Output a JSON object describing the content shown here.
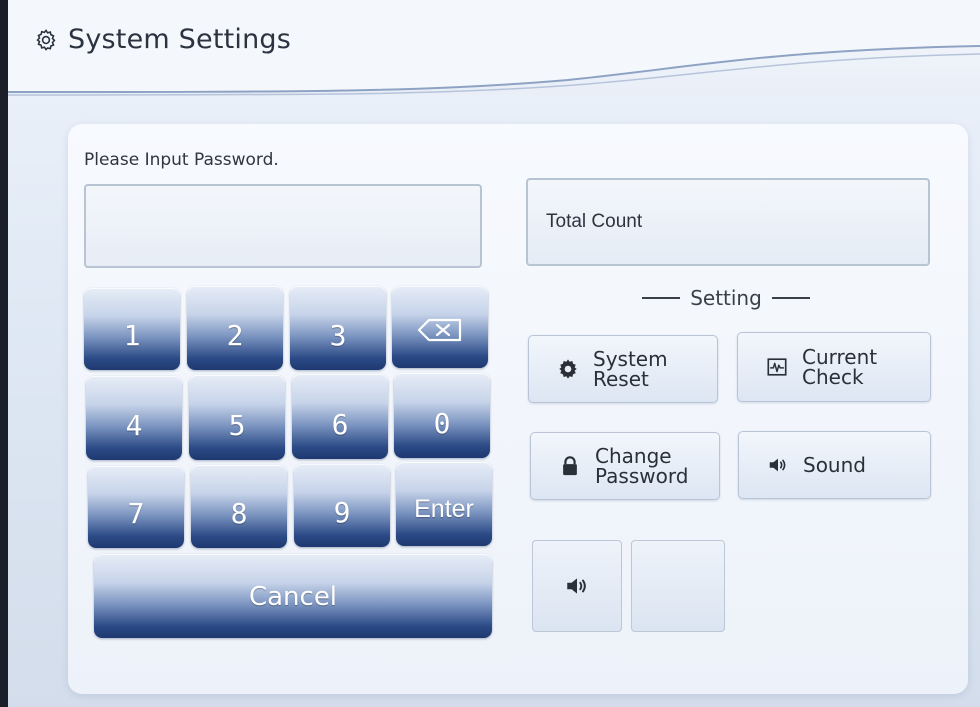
{
  "header": {
    "title": "System Settings",
    "icon": "gear-icon"
  },
  "password": {
    "prompt": "Please Input Password.",
    "value": ""
  },
  "keypad": {
    "keys": [
      "1",
      "2",
      "3",
      "4",
      "5",
      "6",
      "0",
      "7",
      "8",
      "9"
    ],
    "enter_label": "Enter",
    "cancel_label": "Cancel",
    "backspace_icon": "backspace-icon"
  },
  "total_count": {
    "label": "Total Count"
  },
  "settings": {
    "section_title": "Setting",
    "buttons": [
      {
        "label": "System\nReset",
        "icon": "gear-icon"
      },
      {
        "label": "Current\nCheck",
        "icon": "waveform-icon"
      },
      {
        "label": "Change\nPassword",
        "icon": "lock-icon"
      },
      {
        "label": "Sound",
        "icon": "speaker-icon"
      }
    ]
  },
  "volume": {
    "icon": "speaker-icon"
  },
  "colors": {
    "key_dark": "#1e3970",
    "key_light": "#e7edf7",
    "panel_bg": "#f3f6fb"
  }
}
